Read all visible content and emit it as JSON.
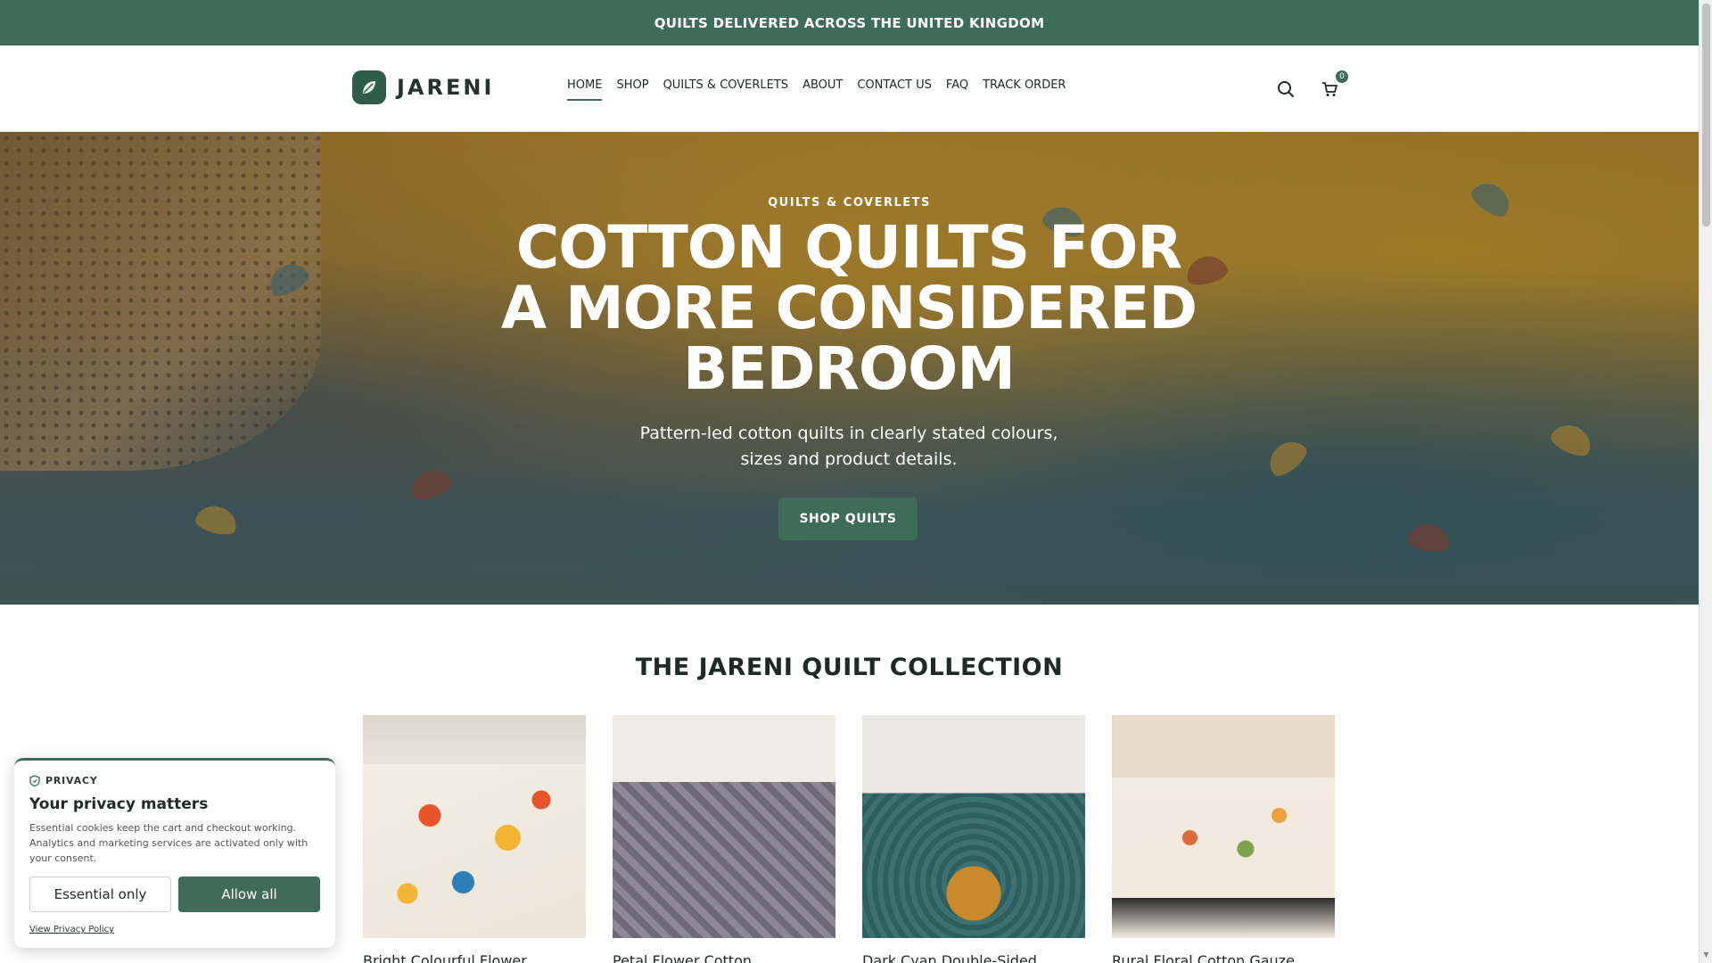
{
  "announcement": {
    "text": "QUILTS DELIVERED ACROSS THE UNITED KINGDOM"
  },
  "header": {
    "logo_text": "JARENI",
    "nav": [
      {
        "label": "HOME",
        "active": true
      },
      {
        "label": "SHOP"
      },
      {
        "label": "QUILTS & COVERLETS"
      },
      {
        "label": "ABOUT"
      },
      {
        "label": "CONTACT US"
      },
      {
        "label": "FAQ"
      },
      {
        "label": "TRACK ORDER"
      }
    ],
    "search_icon": "search-icon",
    "cart_icon": "cart-icon",
    "cart_count": "0"
  },
  "hero": {
    "eyebrow": "QUILTS & COVERLETS",
    "title": "COTTON QUILTS FOR A MORE CONSIDERED BEDROOM",
    "subtitle": "Pattern-led cotton quilts in clearly stated colours, sizes and product details.",
    "cta": "SHOP QUILTS"
  },
  "collection": {
    "title": "THE JARENI QUILT COLLECTION",
    "products": [
      {
        "name": "Bright Colourful Flower"
      },
      {
        "name": "Petal Flower Cotton"
      },
      {
        "name": "Dark Cyan Double-Sided"
      },
      {
        "name": "Rural Floral Cotton Gauze"
      }
    ]
  },
  "privacy": {
    "tag": "PRIVACY",
    "title": "Your privacy matters",
    "text": "Essential cookies keep the cart and checkout working. Analytics and marketing services are activated only with your consent.",
    "essential_label": "Essential only",
    "allow_label": "Allow all",
    "policy_link": "View Privacy Policy"
  },
  "colors": {
    "brand": "#3f6b5a",
    "text": "#1f2a26"
  }
}
